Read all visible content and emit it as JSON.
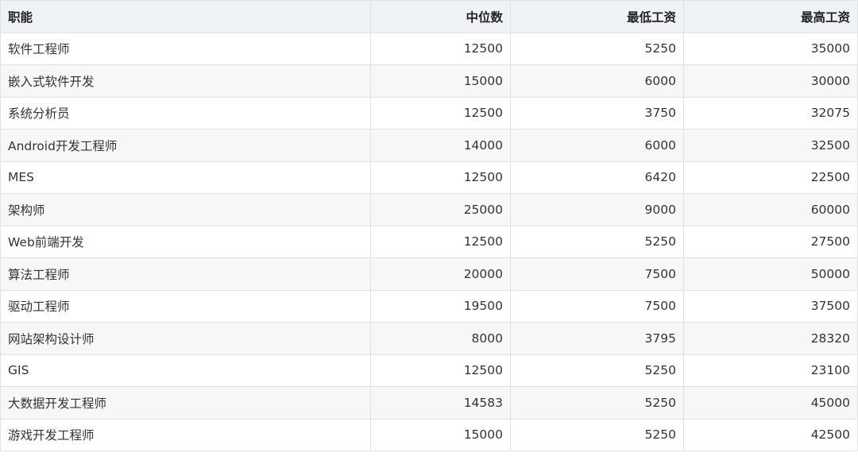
{
  "table": {
    "headers": [
      "职能",
      "中位数",
      "最低工资",
      "最高工资"
    ],
    "rows": [
      [
        "软件工程师",
        "12500",
        "5250",
        "35000"
      ],
      [
        "嵌入式软件开发",
        "15000",
        "6000",
        "30000"
      ],
      [
        "系统分析员",
        "12500",
        "3750",
        "32075"
      ],
      [
        "Android开发工程师",
        "14000",
        "6000",
        "32500"
      ],
      [
        "MES",
        "12500",
        "6420",
        "22500"
      ],
      [
        "架构师",
        "25000",
        "9000",
        "60000"
      ],
      [
        "Web前端开发",
        "12500",
        "5250",
        "27500"
      ],
      [
        "算法工程师",
        "20000",
        "7500",
        "50000"
      ],
      [
        "驱动工程师",
        "19500",
        "7500",
        "37500"
      ],
      [
        "网站架构设计师",
        "8000",
        "3795",
        "28320"
      ],
      [
        "GIS",
        "12500",
        "5250",
        "23100"
      ],
      [
        "大数据开发工程师",
        "14583",
        "5250",
        "45000"
      ],
      [
        "游戏开发工程师",
        "15000",
        "5250",
        "42500"
      ]
    ]
  }
}
